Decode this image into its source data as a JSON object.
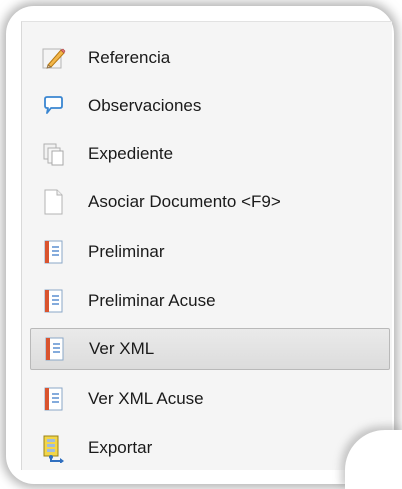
{
  "menu": {
    "items": [
      {
        "label": "Referencia",
        "icon": "pencil-icon"
      },
      {
        "label": "Observaciones",
        "icon": "comment-icon"
      },
      {
        "label": "Expediente",
        "icon": "copy-pages-icon"
      },
      {
        "label": "Asociar Documento <F9>",
        "icon": "blank-document-icon"
      },
      {
        "label": "Preliminar",
        "icon": "notebook-icon"
      },
      {
        "label": "Preliminar Acuse",
        "icon": "notebook-icon"
      },
      {
        "label": "Ver XML",
        "icon": "notebook-icon",
        "state": "highlighted"
      },
      {
        "label": "Ver XML Acuse",
        "icon": "notebook-icon"
      },
      {
        "label": "Exportar",
        "icon": "export-icon",
        "has_submenu": true
      }
    ]
  },
  "colors": {
    "menu_background": "#f5f5f5",
    "highlight_background": "#e2e2e2",
    "highlight_border": "#b9b9b9",
    "text": "#1a1a1a"
  }
}
